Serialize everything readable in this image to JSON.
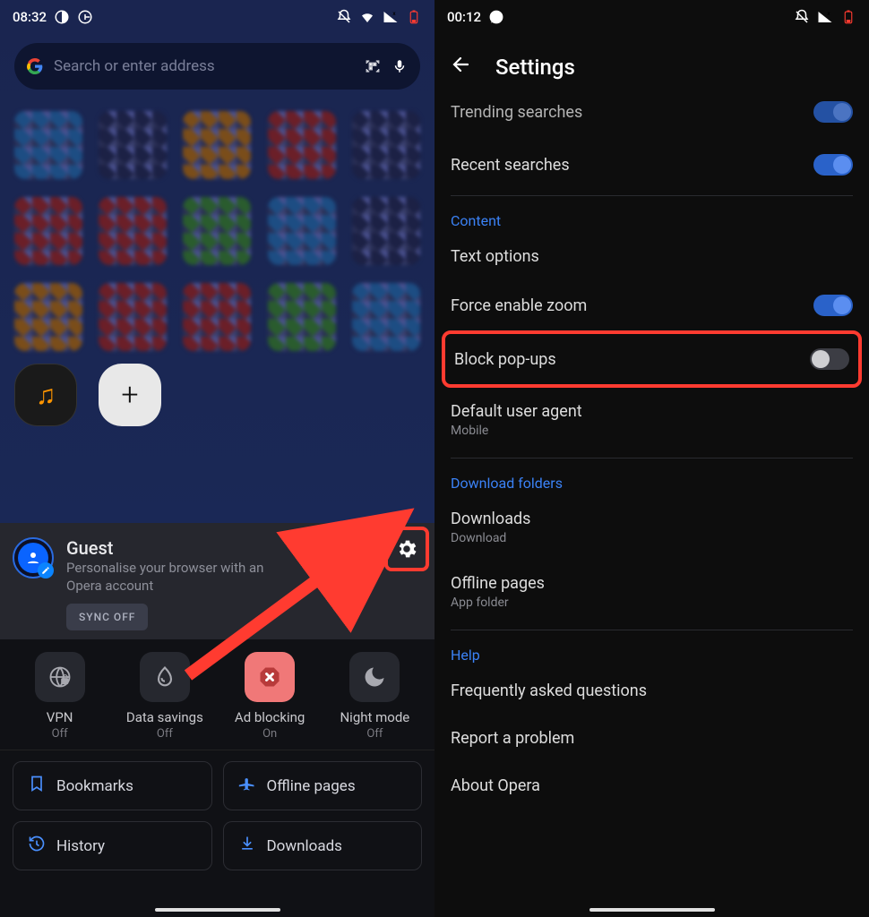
{
  "left": {
    "status": {
      "time": "08:32"
    },
    "search": {
      "placeholder": "Search or enter address"
    },
    "profile": {
      "name": "Guest",
      "subtitle": "Personalise your browser with an Opera account",
      "sync_chip": "SYNC OFF"
    },
    "quick": [
      {
        "label": "VPN",
        "sub": "Off",
        "on": false
      },
      {
        "label": "Data savings",
        "sub": "Off",
        "on": false
      },
      {
        "label": "Ad blocking",
        "sub": "On",
        "on": true
      },
      {
        "label": "Night mode",
        "sub": "Off",
        "on": false
      }
    ],
    "chips": {
      "bookmarks": "Bookmarks",
      "offline": "Offline pages",
      "history": "History",
      "downloads": "Downloads"
    }
  },
  "right": {
    "status": {
      "time": "00:12"
    },
    "title": "Settings",
    "rows": {
      "trending": "Trending searches",
      "recent": "Recent searches",
      "content_header": "Content",
      "text_options": "Text options",
      "force_zoom": "Force enable zoom",
      "block_popups": "Block pop-ups",
      "default_ua": "Default user agent",
      "default_ua_sub": "Mobile",
      "download_header": "Download folders",
      "downloads": "Downloads",
      "downloads_sub": "Download",
      "offline_pages": "Offline pages",
      "offline_pages_sub": "App folder",
      "help_header": "Help",
      "faq": "Frequently asked questions",
      "report": "Report a problem",
      "about": "About Opera"
    }
  }
}
